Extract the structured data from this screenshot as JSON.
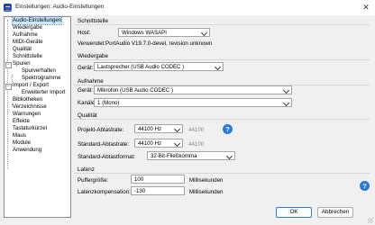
{
  "window": {
    "title": "Einstellungen: Audio-Einstellungen",
    "close_glyph": "✕"
  },
  "tree": {
    "items": [
      {
        "label": "Audio-Einstellungen",
        "selected": true
      },
      {
        "label": "Wiedergabe"
      },
      {
        "label": "Aufnahme"
      },
      {
        "label": "MIDI-Geräte"
      },
      {
        "label": "Qualität"
      },
      {
        "label": "Schnittstelle"
      },
      {
        "label": "Spuren",
        "expander": "−"
      },
      {
        "label": "Spurverhalten"
      },
      {
        "label": "Spektrogramme"
      },
      {
        "label": "Import / Export",
        "expander": "−"
      },
      {
        "label": "Erweiterter Import"
      },
      {
        "label": "Bibliotheken"
      },
      {
        "label": "Verzeichnisse"
      },
      {
        "label": "Warnungen"
      },
      {
        "label": "Effekte"
      },
      {
        "label": "Tastaturkürzel"
      },
      {
        "label": "Maus"
      },
      {
        "label": "Module"
      },
      {
        "label": "Anwendung"
      }
    ]
  },
  "schnittstelle": {
    "heading": "Schnittstelle",
    "host_label": "Host:",
    "host_value": "Windows WASAPI",
    "verwendet_label": "Verwendet:",
    "verwendet_value": "PortAudio V19.7.0-devel, revision unknown"
  },
  "wiedergabe": {
    "heading": "Wiedergabe",
    "geraet_label": "Gerät:",
    "geraet_value": "Lautsprecher (USB Audio CODEC )"
  },
  "aufnahme": {
    "heading": "Aufnahme",
    "geraet_label": "Gerät:",
    "geraet_value": "Mikrofon (USB Audio CODEC )",
    "kanaele_label": "Kanäle:",
    "kanaele_value": "1 (Mono)"
  },
  "qualitaet": {
    "heading": "Qualität",
    "projekt_label": "Projekt-Abtastrate:",
    "projekt_value": "44100 Hz",
    "projekt_text": "44100",
    "standard_label": "Standard-Abtastrate:",
    "standard_value": "44100 Hz",
    "standard_text": "44100",
    "format_label": "Standard-Abtastformat:",
    "format_value": "32-Bit-Fließkomma",
    "help_glyph": "?"
  },
  "latenz": {
    "heading": "Latenz",
    "puffer_label": "Puffergröße:",
    "puffer_value": "100",
    "puffer_unit": "Millisekunden",
    "komp_label": "Latenzkompensation:",
    "komp_value": "-130",
    "komp_unit": "Millisekunden"
  },
  "footer": {
    "help_glyph": "?",
    "ok_label": "OK",
    "cancel_label": "Abbrechen"
  }
}
